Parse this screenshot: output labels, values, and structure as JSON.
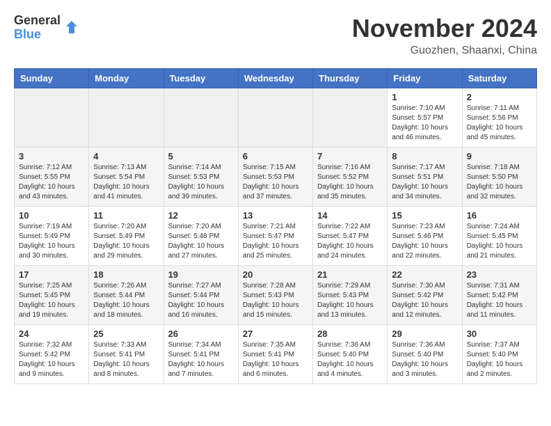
{
  "logo": {
    "general": "General",
    "blue": "Blue",
    "tagline": ""
  },
  "header": {
    "month_year": "November 2024",
    "location": "Guozhen, Shaanxi, China"
  },
  "weekdays": [
    "Sunday",
    "Monday",
    "Tuesday",
    "Wednesday",
    "Thursday",
    "Friday",
    "Saturday"
  ],
  "weeks": [
    [
      {
        "day": "",
        "info": ""
      },
      {
        "day": "",
        "info": ""
      },
      {
        "day": "",
        "info": ""
      },
      {
        "day": "",
        "info": ""
      },
      {
        "day": "",
        "info": ""
      },
      {
        "day": "1",
        "info": "Sunrise: 7:10 AM\nSunset: 5:57 PM\nDaylight: 10 hours\nand 46 minutes."
      },
      {
        "day": "2",
        "info": "Sunrise: 7:11 AM\nSunset: 5:56 PM\nDaylight: 10 hours\nand 45 minutes."
      }
    ],
    [
      {
        "day": "3",
        "info": "Sunrise: 7:12 AM\nSunset: 5:55 PM\nDaylight: 10 hours\nand 43 minutes."
      },
      {
        "day": "4",
        "info": "Sunrise: 7:13 AM\nSunset: 5:54 PM\nDaylight: 10 hours\nand 41 minutes."
      },
      {
        "day": "5",
        "info": "Sunrise: 7:14 AM\nSunset: 5:53 PM\nDaylight: 10 hours\nand 39 minutes."
      },
      {
        "day": "6",
        "info": "Sunrise: 7:15 AM\nSunset: 5:53 PM\nDaylight: 10 hours\nand 37 minutes."
      },
      {
        "day": "7",
        "info": "Sunrise: 7:16 AM\nSunset: 5:52 PM\nDaylight: 10 hours\nand 35 minutes."
      },
      {
        "day": "8",
        "info": "Sunrise: 7:17 AM\nSunset: 5:51 PM\nDaylight: 10 hours\nand 34 minutes."
      },
      {
        "day": "9",
        "info": "Sunrise: 7:18 AM\nSunset: 5:50 PM\nDaylight: 10 hours\nand 32 minutes."
      }
    ],
    [
      {
        "day": "10",
        "info": "Sunrise: 7:19 AM\nSunset: 5:49 PM\nDaylight: 10 hours\nand 30 minutes."
      },
      {
        "day": "11",
        "info": "Sunrise: 7:20 AM\nSunset: 5:49 PM\nDaylight: 10 hours\nand 29 minutes."
      },
      {
        "day": "12",
        "info": "Sunrise: 7:20 AM\nSunset: 5:48 PM\nDaylight: 10 hours\nand 27 minutes."
      },
      {
        "day": "13",
        "info": "Sunrise: 7:21 AM\nSunset: 5:47 PM\nDaylight: 10 hours\nand 25 minutes."
      },
      {
        "day": "14",
        "info": "Sunrise: 7:22 AM\nSunset: 5:47 PM\nDaylight: 10 hours\nand 24 minutes."
      },
      {
        "day": "15",
        "info": "Sunrise: 7:23 AM\nSunset: 5:46 PM\nDaylight: 10 hours\nand 22 minutes."
      },
      {
        "day": "16",
        "info": "Sunrise: 7:24 AM\nSunset: 5:45 PM\nDaylight: 10 hours\nand 21 minutes."
      }
    ],
    [
      {
        "day": "17",
        "info": "Sunrise: 7:25 AM\nSunset: 5:45 PM\nDaylight: 10 hours\nand 19 minutes."
      },
      {
        "day": "18",
        "info": "Sunrise: 7:26 AM\nSunset: 5:44 PM\nDaylight: 10 hours\nand 18 minutes."
      },
      {
        "day": "19",
        "info": "Sunrise: 7:27 AM\nSunset: 5:44 PM\nDaylight: 10 hours\nand 16 minutes."
      },
      {
        "day": "20",
        "info": "Sunrise: 7:28 AM\nSunset: 5:43 PM\nDaylight: 10 hours\nand 15 minutes."
      },
      {
        "day": "21",
        "info": "Sunrise: 7:29 AM\nSunset: 5:43 PM\nDaylight: 10 hours\nand 13 minutes."
      },
      {
        "day": "22",
        "info": "Sunrise: 7:30 AM\nSunset: 5:42 PM\nDaylight: 10 hours\nand 12 minutes."
      },
      {
        "day": "23",
        "info": "Sunrise: 7:31 AM\nSunset: 5:42 PM\nDaylight: 10 hours\nand 11 minutes."
      }
    ],
    [
      {
        "day": "24",
        "info": "Sunrise: 7:32 AM\nSunset: 5:42 PM\nDaylight: 10 hours\nand 9 minutes."
      },
      {
        "day": "25",
        "info": "Sunrise: 7:33 AM\nSunset: 5:41 PM\nDaylight: 10 hours\nand 8 minutes."
      },
      {
        "day": "26",
        "info": "Sunrise: 7:34 AM\nSunset: 5:41 PM\nDaylight: 10 hours\nand 7 minutes."
      },
      {
        "day": "27",
        "info": "Sunrise: 7:35 AM\nSunset: 5:41 PM\nDaylight: 10 hours\nand 6 minutes."
      },
      {
        "day": "28",
        "info": "Sunrise: 7:36 AM\nSunset: 5:40 PM\nDaylight: 10 hours\nand 4 minutes."
      },
      {
        "day": "29",
        "info": "Sunrise: 7:36 AM\nSunset: 5:40 PM\nDaylight: 10 hours\nand 3 minutes."
      },
      {
        "day": "30",
        "info": "Sunrise: 7:37 AM\nSunset: 5:40 PM\nDaylight: 10 hours\nand 2 minutes."
      }
    ]
  ]
}
